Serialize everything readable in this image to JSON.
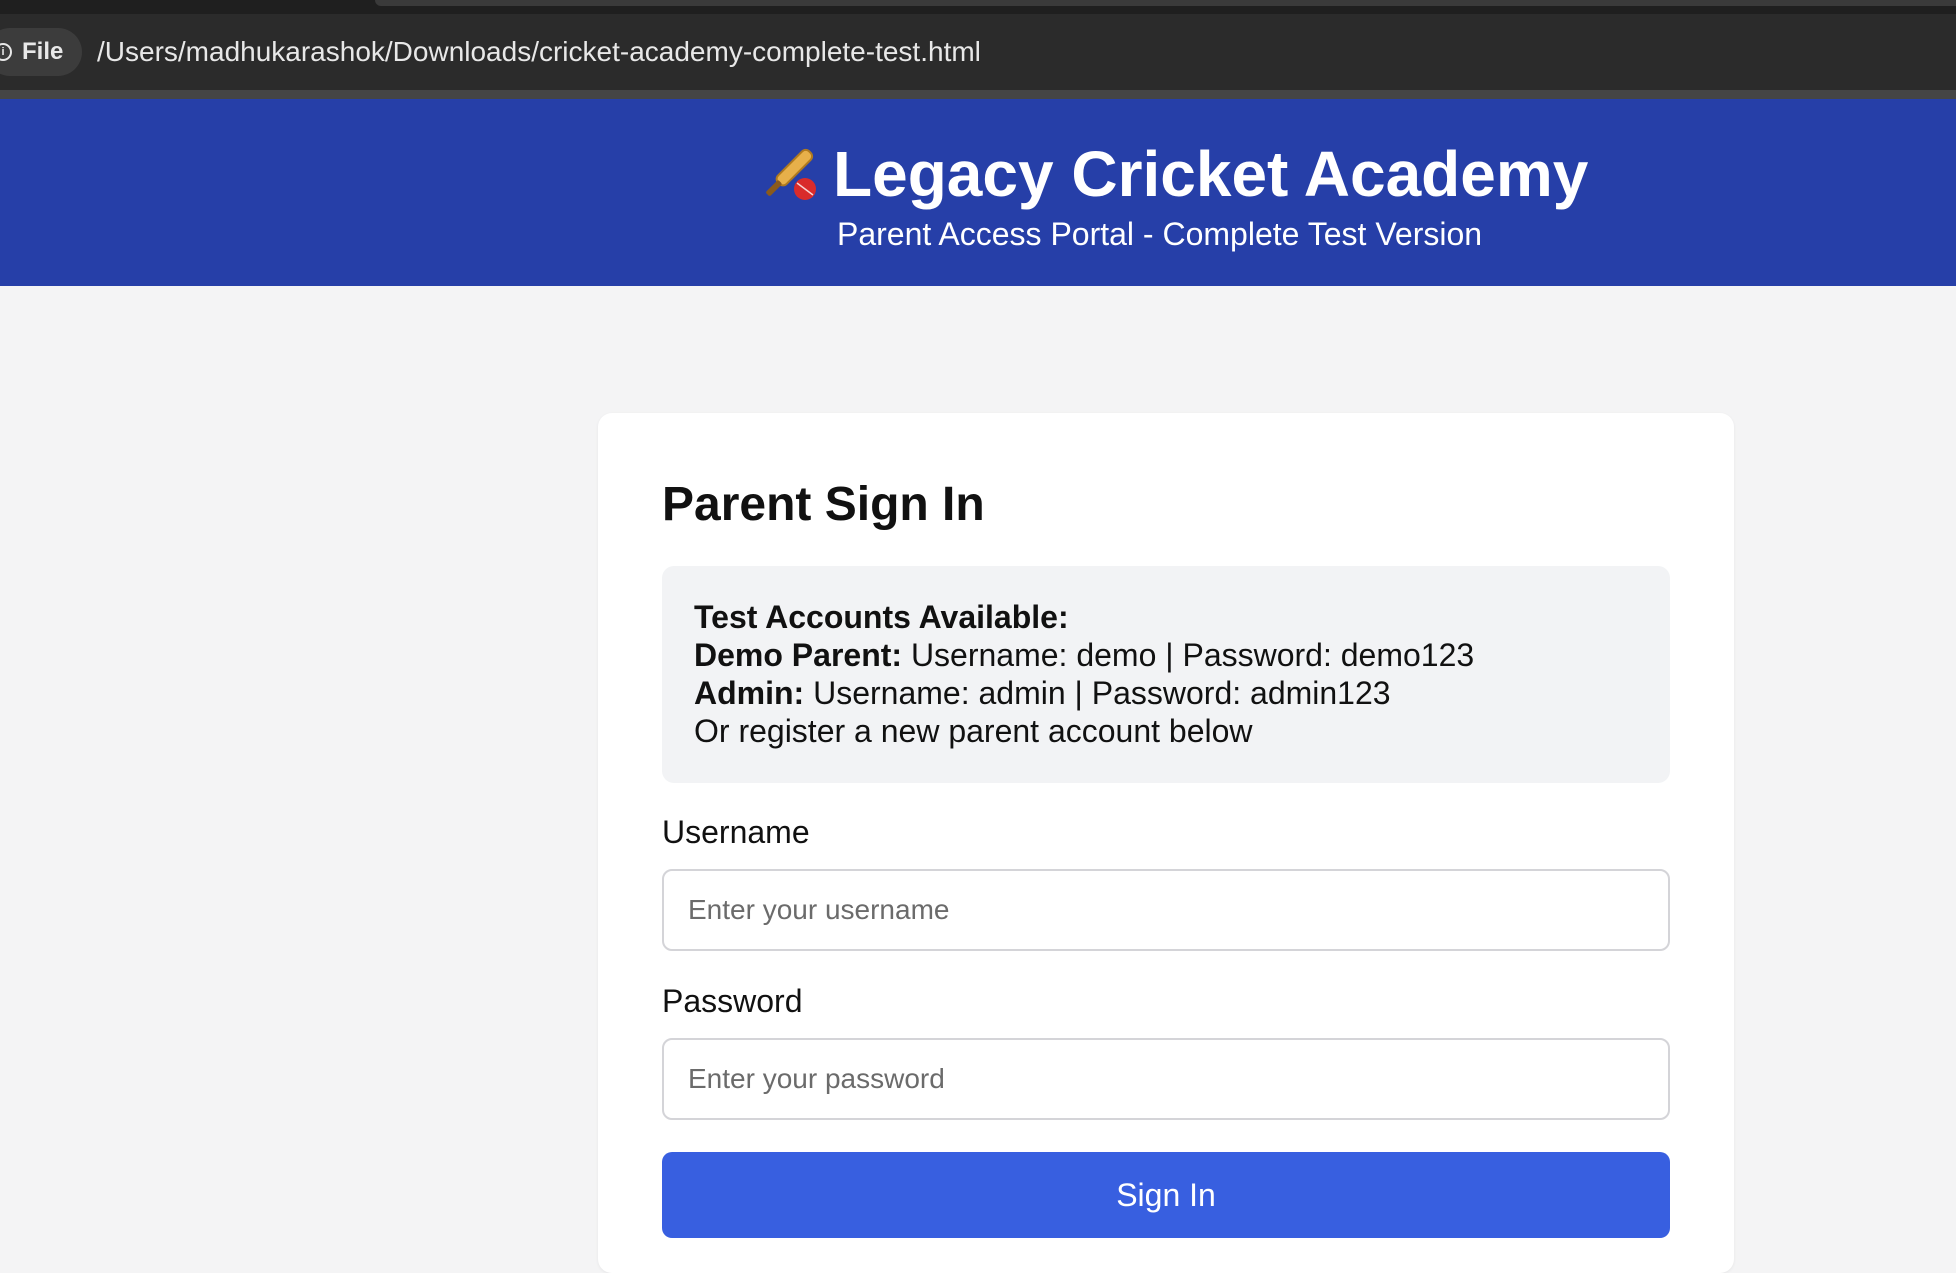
{
  "browser": {
    "file_chip_label": "File",
    "url": "/Users/madhukarashok/Downloads/cricket-academy-complete-test.html"
  },
  "header": {
    "title": "Legacy Cricket Academy",
    "subtitle": "Parent Access Portal - Complete Test Version",
    "icon": "cricket-bat-ball-icon",
    "background_color": "#263fa8"
  },
  "login": {
    "title": "Parent Sign In",
    "test_accounts": {
      "heading": "Test Accounts Available:",
      "demo_label": "Demo Parent:",
      "demo_credentials": "Username: demo | Password: demo123",
      "admin_label": "Admin:",
      "admin_credentials": "Username: admin | Password: admin123",
      "register_note": "Or register a new parent account below"
    },
    "username": {
      "label": "Username",
      "value": "",
      "placeholder": "Enter your username"
    },
    "password": {
      "label": "Password",
      "value": "",
      "placeholder": "Enter your password"
    },
    "submit_label": "Sign In",
    "button_color": "#385fe0"
  }
}
